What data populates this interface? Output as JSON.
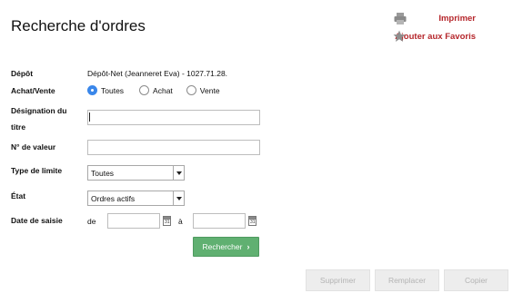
{
  "page": {
    "title": "Recherche d'ordres"
  },
  "top_links": {
    "print_label": "Imprimer",
    "print_icon": "printer-icon",
    "favorites_label": "Ajouter aux Favoris",
    "favorites_icon": "star-icon",
    "color": "#b5262b"
  },
  "form": {
    "depot": {
      "label": "Dépôt",
      "value": "Dépôt-Net (Jeanneret Eva) - 1027.71.28."
    },
    "achat_vente": {
      "label": "Achat/Vente",
      "options": [
        {
          "label": "Toutes",
          "checked": true
        },
        {
          "label": "Achat",
          "checked": false
        },
        {
          "label": "Vente",
          "checked": false
        }
      ]
    },
    "designation": {
      "label_line1": "Désignation du",
      "label_line2": "titre",
      "value": "",
      "placeholder": ""
    },
    "numero_valeur": {
      "label": "N° de valeur",
      "value": "",
      "placeholder": ""
    },
    "type_limite": {
      "label": "Type de limite",
      "selected": "Toutes"
    },
    "etat": {
      "label": "État",
      "selected": "Ordres actifs"
    },
    "date_saisie": {
      "label": "Date de saisie",
      "from_label": "de",
      "to_label": "à",
      "from_value": "",
      "to_value": "",
      "calendar_day": "31"
    },
    "search_button": {
      "label": "Rechercher",
      "color": "#60b071"
    }
  },
  "bottom_buttons": {
    "delete_label": "Supprimer",
    "replace_label": "Remplacer",
    "copy_label": "Copier"
  }
}
